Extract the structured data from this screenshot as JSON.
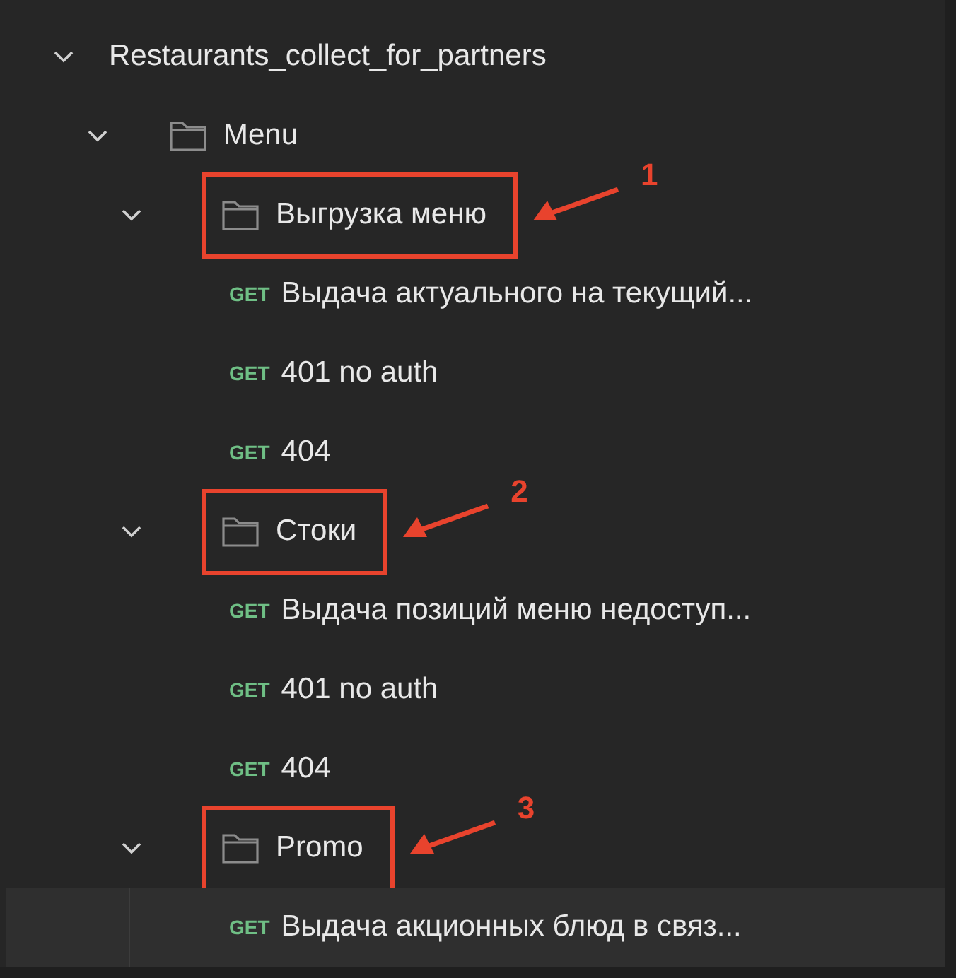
{
  "tree": [
    {
      "kind": "collection",
      "label": "Restaurants_collect_for_partners",
      "expanded": true,
      "selected": false,
      "children": [
        {
          "kind": "folder",
          "label": "Menu",
          "expanded": true,
          "selected": false,
          "children": [
            {
              "kind": "folder",
              "label": "Выгрузка меню",
              "expanded": true,
              "selected": false,
              "annotation": "1",
              "children": [
                {
                  "kind": "request",
                  "method": "GET",
                  "label": "Выдача актуального на текущий...",
                  "selected": false
                },
                {
                  "kind": "request",
                  "method": "GET",
                  "label": "401 no auth",
                  "selected": false
                },
                {
                  "kind": "request",
                  "method": "GET",
                  "label": "404",
                  "selected": false
                }
              ]
            },
            {
              "kind": "folder",
              "label": "Стоки",
              "expanded": true,
              "selected": false,
              "annotation": "2",
              "children": [
                {
                  "kind": "request",
                  "method": "GET",
                  "label": "Выдача позиций меню недоступ...",
                  "selected": false
                },
                {
                  "kind": "request",
                  "method": "GET",
                  "label": "401 no auth",
                  "selected": false
                },
                {
                  "kind": "request",
                  "method": "GET",
                  "label": "404",
                  "selected": false
                }
              ]
            },
            {
              "kind": "folder",
              "label": "Promo",
              "expanded": true,
              "selected": false,
              "annotation": "3",
              "children": [
                {
                  "kind": "request",
                  "method": "GET",
                  "label": "Выдача акционных блюд в связ...",
                  "selected": true
                }
              ]
            }
          ]
        }
      ]
    }
  ]
}
